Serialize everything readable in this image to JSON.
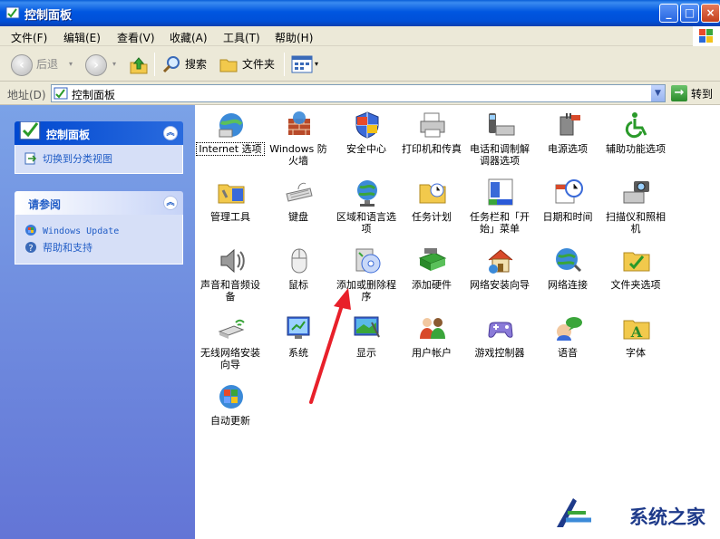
{
  "window": {
    "title": "控制面板"
  },
  "menubar": {
    "items": [
      "文件(F)",
      "编辑(E)",
      "查看(V)",
      "收藏(A)",
      "工具(T)",
      "帮助(H)"
    ]
  },
  "toolbar": {
    "back": "后退",
    "search": "搜索",
    "folders": "文件夹"
  },
  "address": {
    "label": "地址(D)",
    "value": "控制面板",
    "go": "转到"
  },
  "sidebar": {
    "panel1": {
      "title": "控制面板",
      "links": [
        "切换到分类视图"
      ]
    },
    "panel2": {
      "title": "请参阅",
      "links": [
        "Windows Update",
        "帮助和支持"
      ]
    }
  },
  "items": [
    {
      "label": "Internet 选项",
      "icon": "internet-options-icon",
      "selected": true
    },
    {
      "label": "Windows 防火墙",
      "icon": "firewall-icon"
    },
    {
      "label": "安全中心",
      "icon": "security-center-icon"
    },
    {
      "label": "打印机和传真",
      "icon": "printer-fax-icon"
    },
    {
      "label": "电话和调制解调器选项",
      "icon": "phone-modem-icon"
    },
    {
      "label": "电源选项",
      "icon": "power-options-icon"
    },
    {
      "label": "辅助功能选项",
      "icon": "accessibility-icon"
    },
    {
      "label": "管理工具",
      "icon": "admin-tools-icon"
    },
    {
      "label": "键盘",
      "icon": "keyboard-icon"
    },
    {
      "label": "区域和语言选项",
      "icon": "region-language-icon"
    },
    {
      "label": "任务计划",
      "icon": "scheduled-tasks-icon"
    },
    {
      "label": "任务栏和「开始」菜单",
      "icon": "taskbar-icon"
    },
    {
      "label": "日期和时间",
      "icon": "date-time-icon"
    },
    {
      "label": "扫描仪和照相机",
      "icon": "scanner-camera-icon"
    },
    {
      "label": "声音和音频设备",
      "icon": "sound-icon"
    },
    {
      "label": "鼠标",
      "icon": "mouse-icon"
    },
    {
      "label": "添加或删除程序",
      "icon": "add-remove-programs-icon"
    },
    {
      "label": "添加硬件",
      "icon": "add-hardware-icon"
    },
    {
      "label": "网络安装向导",
      "icon": "network-setup-icon"
    },
    {
      "label": "网络连接",
      "icon": "network-connections-icon"
    },
    {
      "label": "文件夹选项",
      "icon": "folder-options-icon"
    },
    {
      "label": "无线网络安装向导",
      "icon": "wireless-setup-icon"
    },
    {
      "label": "系统",
      "icon": "system-icon"
    },
    {
      "label": "显示",
      "icon": "display-icon"
    },
    {
      "label": "用户帐户",
      "icon": "user-accounts-icon"
    },
    {
      "label": "游戏控制器",
      "icon": "game-controllers-icon"
    },
    {
      "label": "语音",
      "icon": "speech-icon"
    },
    {
      "label": "字体",
      "icon": "fonts-icon"
    },
    {
      "label": "自动更新",
      "icon": "automatic-updates-icon"
    }
  ],
  "watermark": {
    "text": "系统之家"
  },
  "colors": {
    "titlebar": "#0054e3",
    "sidebar": "#7ba2e7",
    "arrow": "#e8202a"
  }
}
